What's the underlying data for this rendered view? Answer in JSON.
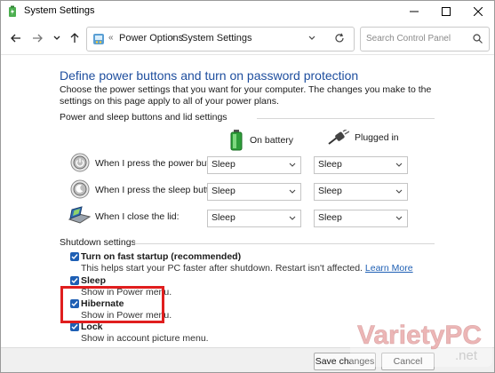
{
  "window": {
    "title": "System Settings"
  },
  "nav": {
    "breadcrumb": [
      "Power Options",
      "System Settings"
    ],
    "search_placeholder": "Search Control Panel"
  },
  "page": {
    "title": "Define power buttons and turn on password protection",
    "intro": "Choose the power settings that you want for your computer. The changes you make to the settings on this page apply to all of your power plans."
  },
  "power_section": {
    "heading": "Power and sleep buttons and lid settings",
    "columns": [
      "On battery",
      "Plugged in"
    ],
    "rows": [
      {
        "label": "When I press the power button:",
        "battery": "Sleep",
        "plugged": "Sleep"
      },
      {
        "label": "When I press the sleep button:",
        "battery": "Sleep",
        "plugged": "Sleep"
      },
      {
        "label": "When I close the lid:",
        "battery": "Sleep",
        "plugged": "Sleep"
      }
    ]
  },
  "shutdown_section": {
    "heading": "Shutdown settings",
    "options": [
      {
        "title": "Turn on fast startup (recommended)",
        "desc": "This helps start your PC faster after shutdown. Restart isn't affected.",
        "link": "Learn More",
        "checked": true
      },
      {
        "title": "Sleep",
        "desc": "Show in Power menu.",
        "checked": true
      },
      {
        "title": "Hibernate",
        "desc": "Show in Power menu.",
        "checked": true
      },
      {
        "title": "Lock",
        "desc": "Show in account picture menu.",
        "checked": true
      }
    ]
  },
  "footer": {
    "save_label": "Save changes",
    "cancel_label": "Cancel"
  },
  "watermark": {
    "text_main": "VarietyPC",
    "text_sub": ".net"
  },
  "colors": {
    "accent": "#1e5fb4",
    "title_blue": "#1e4e9e",
    "highlight_red": "#e01e1e"
  }
}
